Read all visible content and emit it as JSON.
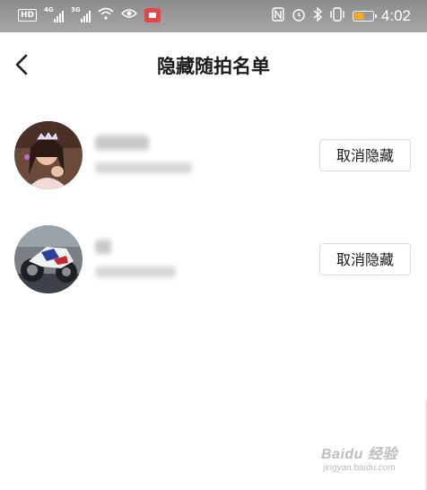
{
  "statusbar": {
    "hd_label": "HD",
    "net1_gen": "4G",
    "net2_gen": "3G",
    "time": "4:02",
    "battery_level": 0.45,
    "battery_color": "#f5a623",
    "icons": [
      "hd-icon",
      "signal-icon",
      "signal-icon",
      "wifi-icon",
      "eye-icon",
      "screen-record-icon",
      "nfc-icon",
      "alarm-icon",
      "bluetooth-icon",
      "vibrate-icon",
      "battery-icon"
    ]
  },
  "header": {
    "back_icon": "chevron-left-icon",
    "title": "隐藏随拍名单"
  },
  "list": {
    "items": [
      {
        "action_label": "取消隐藏"
      },
      {
        "action_label": "取消隐藏"
      }
    ]
  },
  "watermark": {
    "line1": "Baidu 经验",
    "line2": "jingyan.baidu.com"
  }
}
